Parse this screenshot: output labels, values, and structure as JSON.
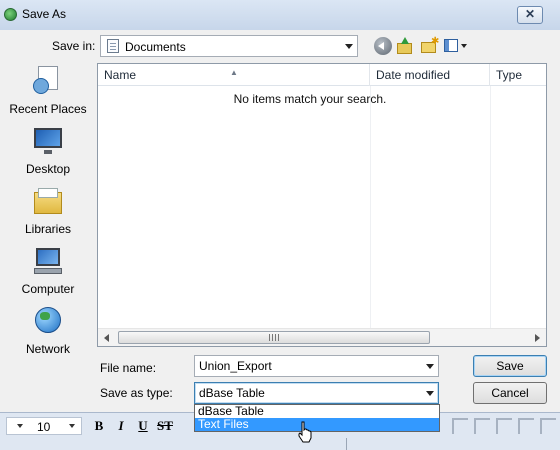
{
  "window": {
    "title": "Save As",
    "close_glyph": "✕"
  },
  "toolbar": {
    "save_in_label": "Save in:",
    "save_in_value": "Documents",
    "icons": [
      "back-icon",
      "up-folder-icon",
      "new-folder-icon",
      "views-icon"
    ]
  },
  "places": [
    {
      "label": "Recent Places",
      "icon": "recent-places-icon"
    },
    {
      "label": "Desktop",
      "icon": "desktop-icon"
    },
    {
      "label": "Libraries",
      "icon": "libraries-icon"
    },
    {
      "label": "Computer",
      "icon": "computer-icon"
    },
    {
      "label": "Network",
      "icon": "network-icon"
    }
  ],
  "filelist": {
    "columns": [
      "Name",
      "Date modified",
      "Type"
    ],
    "sort_glyph": "▲",
    "empty_message": "No items match your search.",
    "scroll_grip": "|||"
  },
  "form": {
    "file_name_label": "File name:",
    "file_name_value": "Union_Export",
    "save_as_type_label": "Save as type:",
    "save_as_type_value": "dBase Table",
    "save_button": "Save",
    "cancel_button": "Cancel",
    "type_options": [
      "dBase Table",
      "Text Files"
    ],
    "highlighted_option": "Text Files"
  },
  "background_app": {
    "font_size": "10",
    "format_buttons": [
      "B",
      "I",
      "U",
      "ST"
    ]
  },
  "colors": {
    "selection": "#3399ff",
    "focus_border": "#3c7fb1"
  }
}
